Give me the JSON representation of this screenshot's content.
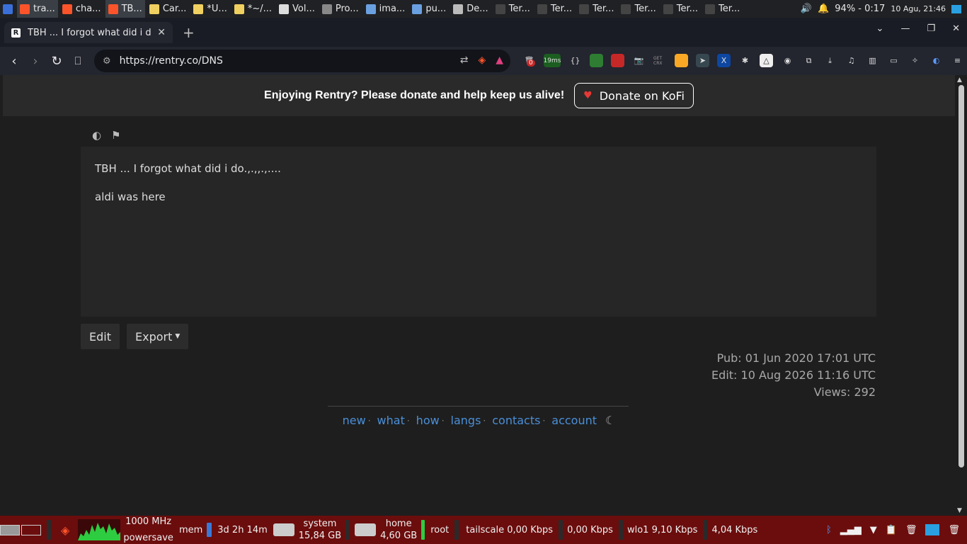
{
  "taskbar": {
    "apps": [
      {
        "label": "tra...",
        "color": "#fb542b",
        "active": true
      },
      {
        "label": "cha...",
        "color": "#fb542b"
      },
      {
        "label": "TB...",
        "color": "#fb542b",
        "active": true
      },
      {
        "label": "Car...",
        "color": "#f0d060"
      },
      {
        "label": "*U...",
        "color": "#f0d060"
      },
      {
        "label": "*~/...",
        "color": "#f0d060"
      },
      {
        "label": "Vol...",
        "color": "#dddddd"
      },
      {
        "label": "Pro...",
        "color": "#888888"
      },
      {
        "label": "ima...",
        "color": "#6aa0e0"
      },
      {
        "label": "pu...",
        "color": "#6aa0e0"
      },
      {
        "label": "De...",
        "color": "#bbbbbb"
      },
      {
        "label": "Ter...",
        "color": "#444444"
      },
      {
        "label": "Ter...",
        "color": "#444444"
      },
      {
        "label": "Ter...",
        "color": "#444444"
      },
      {
        "label": "Ter...",
        "color": "#444444"
      },
      {
        "label": "Ter...",
        "color": "#444444"
      },
      {
        "label": "Ter...",
        "color": "#444444"
      }
    ],
    "battery": "94% - 0:17",
    "datetime": "10 Agu, 21:46"
  },
  "browser": {
    "tab_title": "TBH ... I forgot what did i do",
    "tab_favicon": "R",
    "url": "https://rentry.co/DNS",
    "ext_badge_count": "0",
    "ext_timer": "19ms"
  },
  "page": {
    "banner_text": "Enjoying Rentry? Please donate and help keep us alive!",
    "donate_label": "Donate on KoFi",
    "entry_lines": [
      "TBH ... I forgot what did i do.,.,,.,....",
      "aldi was here"
    ],
    "edit_label": "Edit",
    "export_label": "Export",
    "pub": "Pub: 01 Jun 2020 17:01 UTC",
    "edit": "Edit: 10 Aug 2026 11:16 UTC",
    "views": "Views: 292",
    "footer_links": [
      "new",
      "what",
      "how",
      "langs",
      "contacts",
      "account"
    ]
  },
  "panel": {
    "cpu_freq": "1000 MHz",
    "cpu_gov": "powersave",
    "mem_label": "mem",
    "uptime": "3d 2h 14m",
    "system_label": "system",
    "system_size": "15,84 GB",
    "home_label": "home",
    "home_size": "4,60 GB",
    "root_label": "root",
    "tailscale": "tailscale 0,00 Kbps",
    "tailscale2": "0,00 Kbps",
    "wlo1": "wlo1  9,10 Kbps",
    "wlo1_2": "4,04 Kbps"
  }
}
